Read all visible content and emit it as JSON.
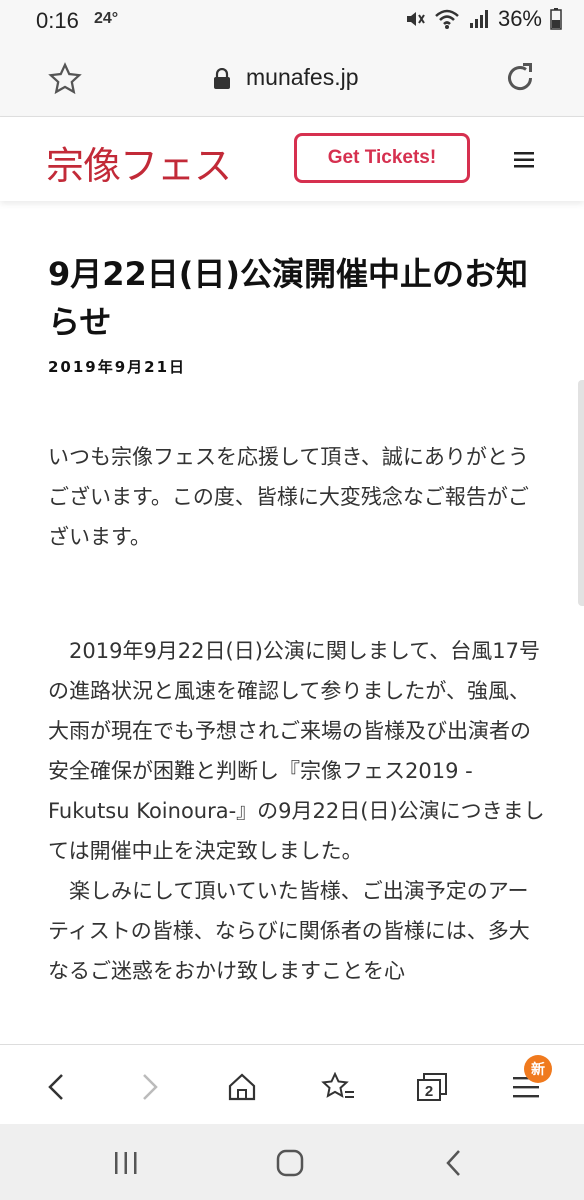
{
  "status": {
    "time": "0:16",
    "temp": "24°",
    "battery": "36%"
  },
  "browser": {
    "url": "munafes.jp"
  },
  "site": {
    "logo": "宗像フェス",
    "ticket_button": "Get Tickets!"
  },
  "article": {
    "title": "9月22日(日)公演開催中止のお知らせ",
    "date": "2019年9月21日",
    "paragraphs": [
      "いつも宗像フェスを応援して頂き、誠にありがとうございます。この度、皆様に大変残念なご報告がございます。",
      "2019年9月22日(日)公演に関しまして、台風17号の進路状況と風速を確認して参りましたが、強風、大雨が現在でも予想されご来場の皆様及び出演者の安全確保が困難と判断し『宗像フェス2019 -Fukutsu Koinoura-』の9月22日(日)公演につきましては開催中止を決定致しました。",
      "楽しみにして頂いていた皆様、ご出演予定のアーティストの皆様、ならびに関係者の皆様には、多大なるご迷惑をおかけ致しますことを心"
    ]
  },
  "bottombar": {
    "tabs_count": "2",
    "badge": "新"
  },
  "colors": {
    "brand": "#c22a38",
    "ticket": "#d6304f",
    "badge": "#f07a1e"
  }
}
